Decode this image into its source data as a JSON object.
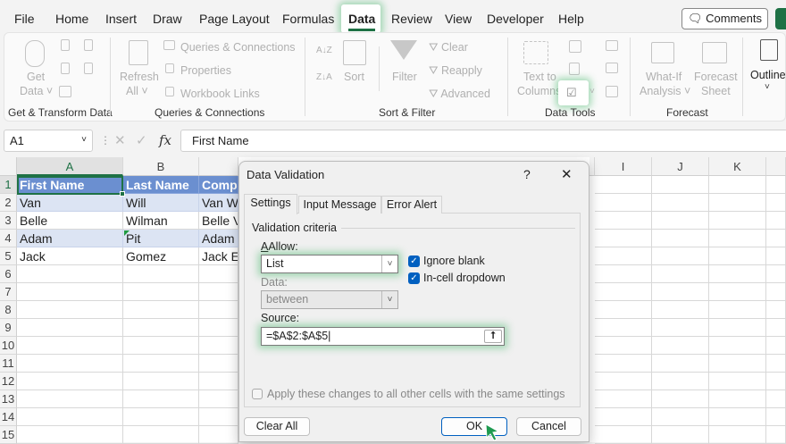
{
  "menu": {
    "tabs": [
      "File",
      "Home",
      "Insert",
      "Draw",
      "Page Layout",
      "Formulas",
      "Data",
      "Review",
      "View",
      "Developer",
      "Help"
    ],
    "active": "Data",
    "comments": "Comments"
  },
  "ribbon": {
    "get_transform": {
      "get_data_1": "Get",
      "get_data_2": "Data",
      "label": "Get & Transform Data"
    },
    "queries": {
      "refresh_1": "Refresh",
      "refresh_2": "All",
      "queries_connections": "Queries & Connections",
      "properties": "Properties",
      "workbook_links": "Workbook Links",
      "label": "Queries & Connections"
    },
    "sort_filter": {
      "sort": "Sort",
      "filter": "Filter",
      "clear": "Clear",
      "reapply": "Reapply",
      "advanced": "Advanced",
      "label": "Sort & Filter",
      "az": "A↓Z",
      "za": "Z↓A"
    },
    "data_tools": {
      "text_to_1": "Text to",
      "text_to_2": "Columns",
      "label": "Data Tools"
    },
    "forecast": {
      "whatif_1": "What-If",
      "whatif_2": "Analysis",
      "sheet_1": "Forecast",
      "sheet_2": "Sheet",
      "label": "Forecast"
    },
    "outline": {
      "label": "Outline"
    }
  },
  "formula_bar": {
    "name_box": "A1",
    "fx": "fx",
    "content": "First Name"
  },
  "sheet": {
    "columns": [
      "A",
      "B",
      "C",
      "I",
      "J",
      "K"
    ],
    "rows": [
      "1",
      "2",
      "3",
      "4",
      "5",
      "6",
      "7",
      "8",
      "9",
      "10",
      "11",
      "12",
      "13",
      "14",
      "15"
    ],
    "cells": [
      [
        "First Name",
        "Last Name",
        "Compl"
      ],
      [
        "Van",
        "Will",
        "Van W"
      ],
      [
        "Belle",
        "Wilman",
        "Belle V"
      ],
      [
        "Adam",
        "Pit",
        "Adam J"
      ],
      [
        "Jack",
        "Gomez",
        "Jack Er"
      ]
    ]
  },
  "dialog": {
    "title": "Data Validation",
    "help": "?",
    "close": "✕",
    "tabs": [
      "Settings",
      "Input Message",
      "Error Alert"
    ],
    "criteria": "Validation criteria",
    "allow_label": "Allow:",
    "allow_value": "List",
    "data_label": "Data:",
    "data_value": "between",
    "source_label": "Source:",
    "source_value": "=$A$2:$A$5",
    "ignore_blank": "Ignore blank",
    "ignore_blank_checked": true,
    "in_cell_dropdown": "In-cell dropdown",
    "in_cell_dropdown_checked": true,
    "apply_all": "Apply these changes to all other cells with the same settings",
    "apply_all_checked": false,
    "clear_all": "Clear All",
    "ok": "OK",
    "cancel": "Cancel"
  },
  "colors": {
    "accent": "#1e7145",
    "header_fill": "#6b8fd0",
    "band_fill": "#dce4f3",
    "highlight": "#3cb464"
  }
}
